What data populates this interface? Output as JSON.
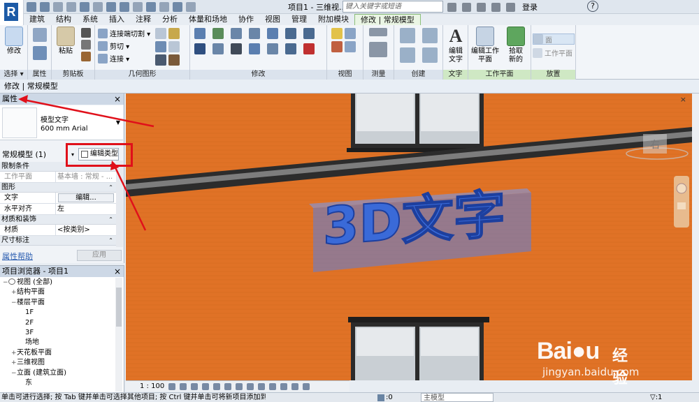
{
  "title_bar": {
    "window_title": "项目1 - 三维视...",
    "search_placeholder": "键入关键字或短语",
    "login_label": "登录",
    "help_label": "?"
  },
  "tabs": [
    {
      "label": "建筑"
    },
    {
      "label": "结构"
    },
    {
      "label": "系统"
    },
    {
      "label": "插入"
    },
    {
      "label": "注释"
    },
    {
      "label": "分析"
    },
    {
      "label": "体量和场地"
    },
    {
      "label": "协作"
    },
    {
      "label": "视图"
    },
    {
      "label": "管理"
    },
    {
      "label": "附加模块"
    },
    {
      "label": "修改 | 常规模型"
    }
  ],
  "ribbon": {
    "select_panel": {
      "modify_label": "修改",
      "panel_label": "选择 ▾"
    },
    "properties_panel": {
      "panel_label": "属性"
    },
    "clipboard_panel": {
      "paste_label": "粘贴",
      "panel_label": "剪贴板"
    },
    "geometry_panel": {
      "join_cut_label": "连接端切割 ▾",
      "cut_label": "剪切 ▾",
      "join_label": "连接 ▾",
      "panel_label": "几何图形"
    },
    "modify_panel": {
      "panel_label": "修改"
    },
    "view_panel": {
      "panel_label": "视图"
    },
    "measure_panel": {
      "panel_label": "测量"
    },
    "create_panel": {
      "panel_label": "创建"
    },
    "text_panel": {
      "edit_text_label": "编辑文字",
      "panel_label": "文字"
    },
    "workplane_panel": {
      "edit_workplane_label": "编辑工作平面",
      "pick_new_label": "拾取新的",
      "panel_label": "工作平面"
    },
    "placement_panel": {
      "face_label": "面",
      "workplane_label": "工作平面",
      "panel_label": "放置"
    }
  },
  "options_bar": {
    "label": "修改 | 常规模型"
  },
  "properties": {
    "title": "属性",
    "type_name_line1": "模型文字",
    "type_name_line2": "600 mm Arial",
    "instance_filter": "常规模型 (1)",
    "edit_type_label": "编辑类型",
    "groups": [
      {
        "name": "限制条件",
        "rows": [
          {
            "key": "工作平面",
            "value": "基本墙 : 常规 - ...",
            "disabled": true
          }
        ]
      },
      {
        "name": "图形",
        "rows": [
          {
            "key": "文字",
            "value": "编辑...",
            "button": true
          },
          {
            "key": "水平对齐",
            "value": "左"
          }
        ]
      },
      {
        "name": "材质和装饰",
        "rows": [
          {
            "key": "材质",
            "value": "<按类别>"
          }
        ]
      },
      {
        "name": "尺寸标注",
        "rows": []
      }
    ],
    "help_label": "属性帮助",
    "apply_label": "应用"
  },
  "project_browser": {
    "title": "项目浏览器 - 项目1",
    "tree": [
      {
        "label": "视图 (全部)",
        "depth": 0,
        "toggle": "−",
        "icon": true
      },
      {
        "label": "结构平面",
        "depth": 1,
        "toggle": "+"
      },
      {
        "label": "楼层平面",
        "depth": 1,
        "toggle": "−"
      },
      {
        "label": "1F",
        "depth": 2,
        "toggle": ""
      },
      {
        "label": "2F",
        "depth": 2,
        "toggle": ""
      },
      {
        "label": "3F",
        "depth": 2,
        "toggle": ""
      },
      {
        "label": "场地",
        "depth": 2,
        "toggle": ""
      },
      {
        "label": "天花板平面",
        "depth": 1,
        "toggle": "+"
      },
      {
        "label": "三维视图",
        "depth": 1,
        "toggle": "+"
      },
      {
        "label": "立面 (建筑立面)",
        "depth": 1,
        "toggle": "−"
      },
      {
        "label": "东",
        "depth": 2,
        "toggle": ""
      }
    ]
  },
  "viewport": {
    "model_text": "3D文字",
    "viewcube_label": "右",
    "close_label": "×"
  },
  "view_control": {
    "scale": "1 : 100"
  },
  "status_bar": {
    "message": "单击可进行选择; 按 Tab 键并单击可选择其他项目; 按 Ctrl 键并单击可将新项目添加到选择",
    "count": ":0",
    "model": "主模型",
    "selection": "▽:1"
  },
  "watermark": {
    "logo": "Bai●u",
    "brand_cn": "经验",
    "url": "jingyan.baidu.com"
  },
  "colors": {
    "wall_orange": "#e07226",
    "text_blue": "#3a6ad8",
    "annotation_red": "#e0101a",
    "context_tab_green": "#3a8f3a"
  }
}
